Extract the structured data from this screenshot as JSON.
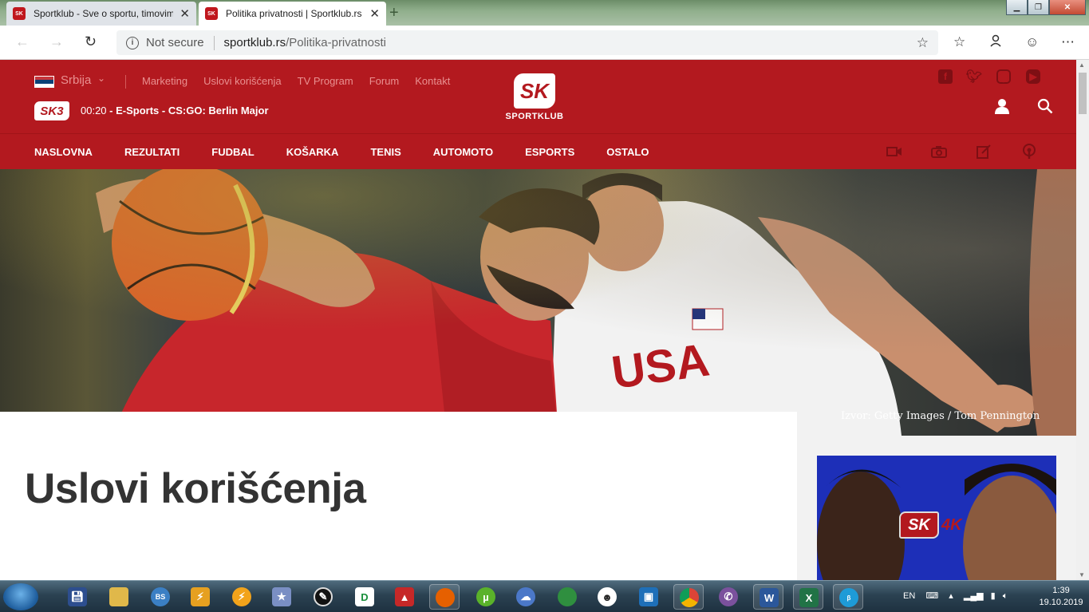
{
  "browser": {
    "tabs": [
      {
        "title": "Sportklub - Sve o sportu, timovim",
        "favicon": "SK",
        "active": false
      },
      {
        "title": "Politika privatnosti | Sportklub.rs",
        "favicon": "SK",
        "active": true
      }
    ],
    "address": {
      "security_label": "Not secure",
      "host": "sportklub.rs",
      "path": "/Politika-privatnosti"
    },
    "window_buttons": [
      "minimize",
      "maximize",
      "close"
    ]
  },
  "site": {
    "country": "Srbija",
    "top_links": [
      "Marketing",
      "Uslovi korišćenja",
      "TV Program",
      "Forum",
      "Kontakt"
    ],
    "channel_badge": "SK3",
    "now_playing": {
      "time": "00:20",
      "text": "- E-Sports - CS:GO: Berlin Major"
    },
    "logo": {
      "mark": "SK",
      "word": "SPORTKLUB"
    },
    "social": [
      "facebook-icon",
      "twitter-icon",
      "instagram-icon",
      "youtube-icon"
    ],
    "menu": [
      "NASLOVNA",
      "REZULTATI",
      "FUDBAL",
      "KOŠARKA",
      "TENIS",
      "AUTOMOTO",
      "ESPORTS",
      "OSTALO"
    ],
    "menu_icons": [
      "video-icon",
      "camera-icon",
      "edit-icon",
      "podcast-icon"
    ],
    "hero_credit": "Izvor: Getty Images / Tom Pennington",
    "page_title": "Uslovi korišćenja",
    "ad": {
      "badge": "SK",
      "suffix": "4K"
    },
    "colors": {
      "brand": "#b3191f",
      "brand_dark": "#7e0f14"
    }
  },
  "taskbar": {
    "language": "EN",
    "time": "1:39",
    "date": "19.10.2019"
  }
}
